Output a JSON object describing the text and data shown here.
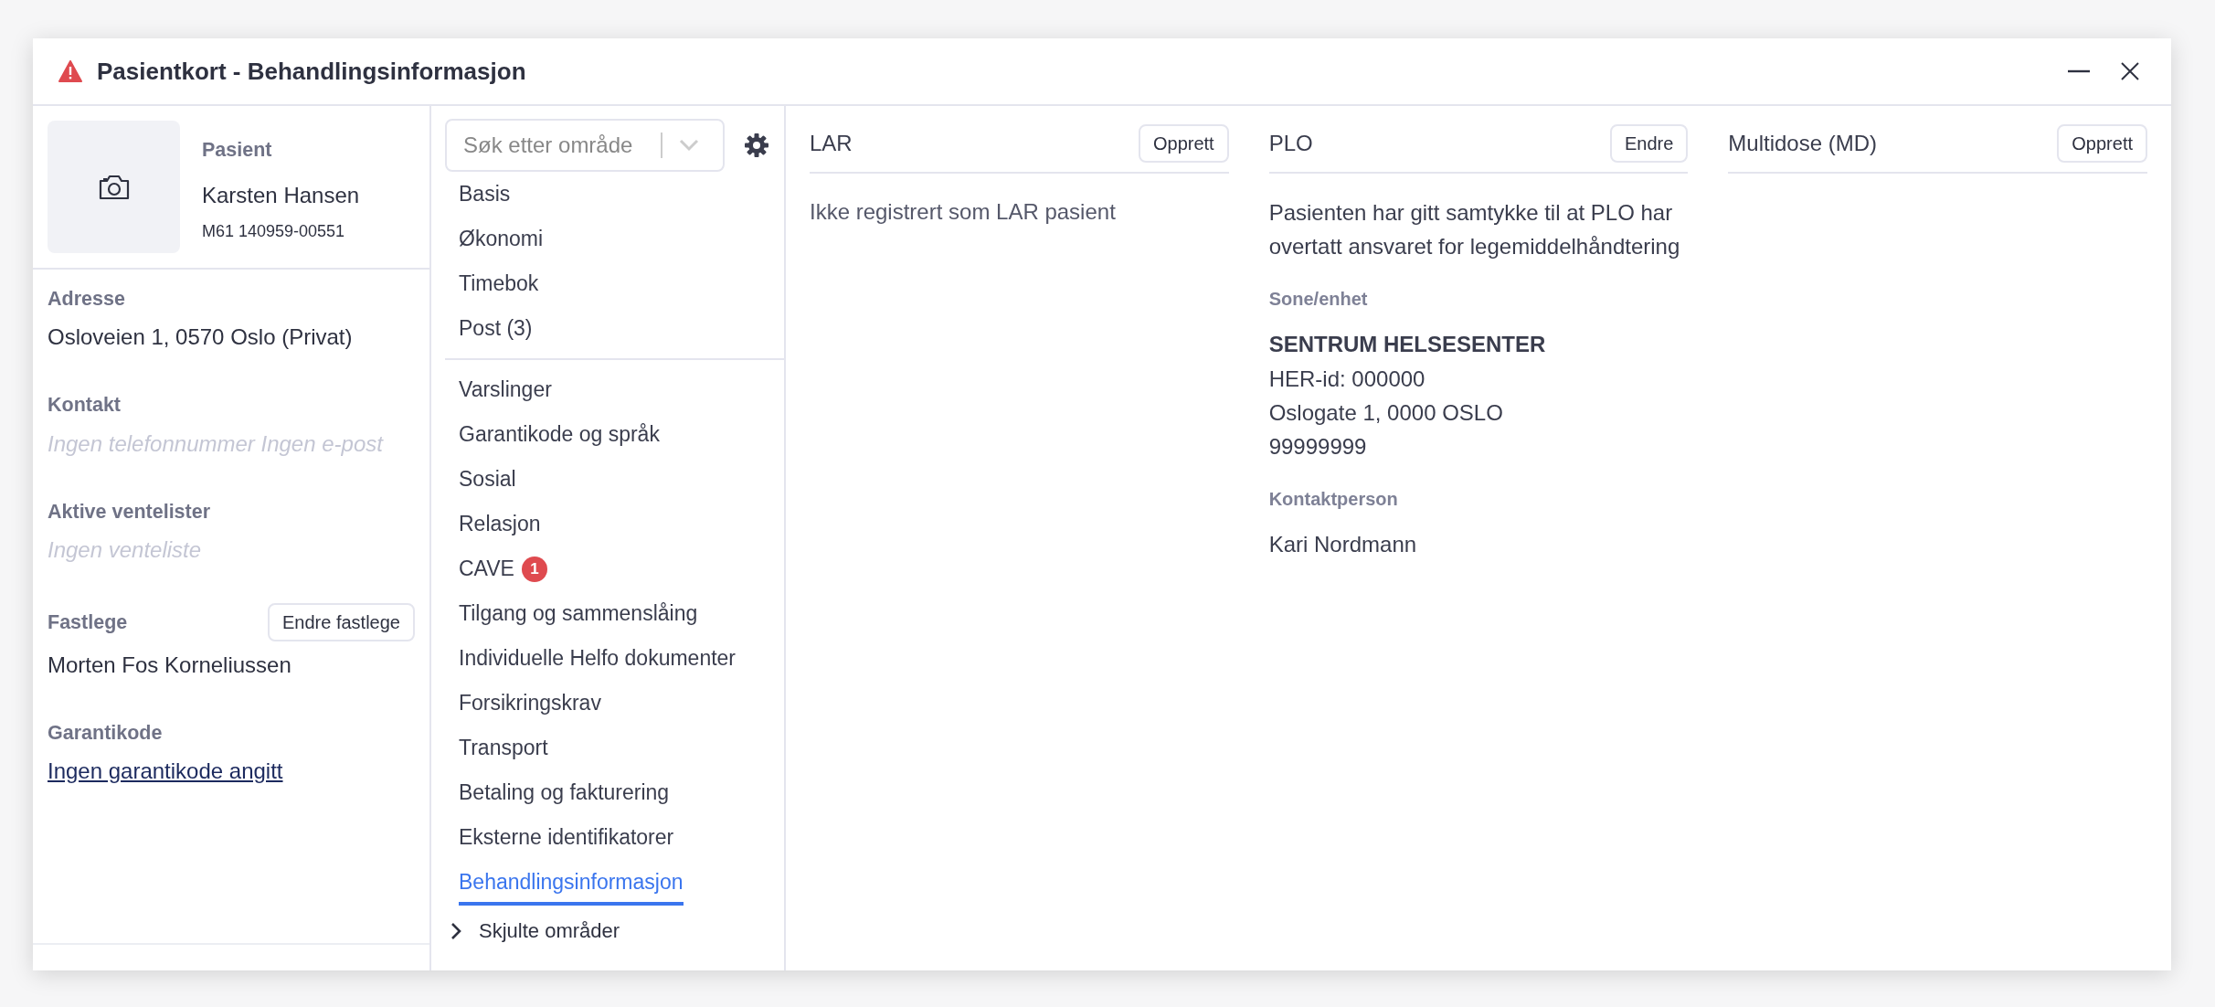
{
  "window": {
    "title": "Pasientkort - Behandlingsinformasjon"
  },
  "patient": {
    "label": "Pasient",
    "name": "Karsten Hansen",
    "id": "M61 140959-00551"
  },
  "sections": [
    {
      "label": "Adresse",
      "kind": "text",
      "value": "Osloveien 1, 0570 Oslo (Privat)"
    },
    {
      "label": "Kontakt",
      "kind": "empty",
      "value": "Ingen telefonnummer Ingen e-post"
    },
    {
      "label": "Aktive ventelister",
      "kind": "empty",
      "value": "Ingen venteliste"
    },
    {
      "label": "Fastlege",
      "kind": "text",
      "value": "Morten Fos Korneliussen",
      "button": "Endre fastlege"
    },
    {
      "label": "Garantikode",
      "kind": "link",
      "value": "Ingen garantikode angitt"
    }
  ],
  "nav": {
    "search": {
      "placeholder": "Søk etter område"
    },
    "groups": [
      [
        {
          "label": "Basis",
          "selected": false
        },
        {
          "label": "Økonomi",
          "selected": false
        },
        {
          "label": "Timebok",
          "selected": false
        },
        {
          "label": "Post (3)",
          "selected": false
        }
      ],
      [
        {
          "label": "Varslinger",
          "selected": false
        },
        {
          "label": "Garantikode og språk",
          "selected": false
        },
        {
          "label": "Sosial",
          "selected": false
        },
        {
          "label": "Relasjon",
          "selected": false
        },
        {
          "label": "CAVE",
          "badge": "1",
          "selected": false
        },
        {
          "label": "Tilgang og sammenslåing",
          "selected": false
        },
        {
          "label": "Individuelle Helfo dokumenter",
          "selected": false
        },
        {
          "label": "Forsikringskrav",
          "selected": false
        },
        {
          "label": "Transport",
          "selected": false
        },
        {
          "label": "Betaling og fakturering",
          "selected": false
        },
        {
          "label": "Eksterne identifikatorer",
          "selected": false
        },
        {
          "label": "Behandlingsinformasjon",
          "selected": true
        }
      ]
    ],
    "hidden": {
      "label": "Skjulte områder",
      "expanded": false
    }
  },
  "panels": [
    {
      "title": "LAR",
      "button": "Opprett",
      "blocks": [
        {
          "kind": "muted",
          "lines": [
            {
              "text": "Ikke registrert som LAR pasient",
              "bold": false
            }
          ]
        }
      ]
    },
    {
      "title": "PLO",
      "button": "Endre",
      "blocks": [
        {
          "kind": "paragraph",
          "lines": [
            {
              "text": "Pasienten har gitt samtykke til at PLO har overtatt ansvaret for legemiddelhåndtering",
              "bold": false
            }
          ]
        },
        {
          "kind": "field",
          "label": "Sone/enhet",
          "lines": [
            {
              "text": "SENTRUM HELSESENTER",
              "bold": true
            },
            {
              "text": "HER-id: 000000",
              "bold": false
            },
            {
              "text": "Oslogate 1, 0000 OSLO",
              "bold": false
            },
            {
              "text": "99999999",
              "bold": false
            }
          ]
        },
        {
          "kind": "field",
          "label": "Kontaktperson",
          "lines": [
            {
              "text": "Kari Nordmann",
              "bold": false
            }
          ]
        }
      ]
    },
    {
      "title": "Multidose (MD)",
      "button": "Opprett"
    }
  ]
}
